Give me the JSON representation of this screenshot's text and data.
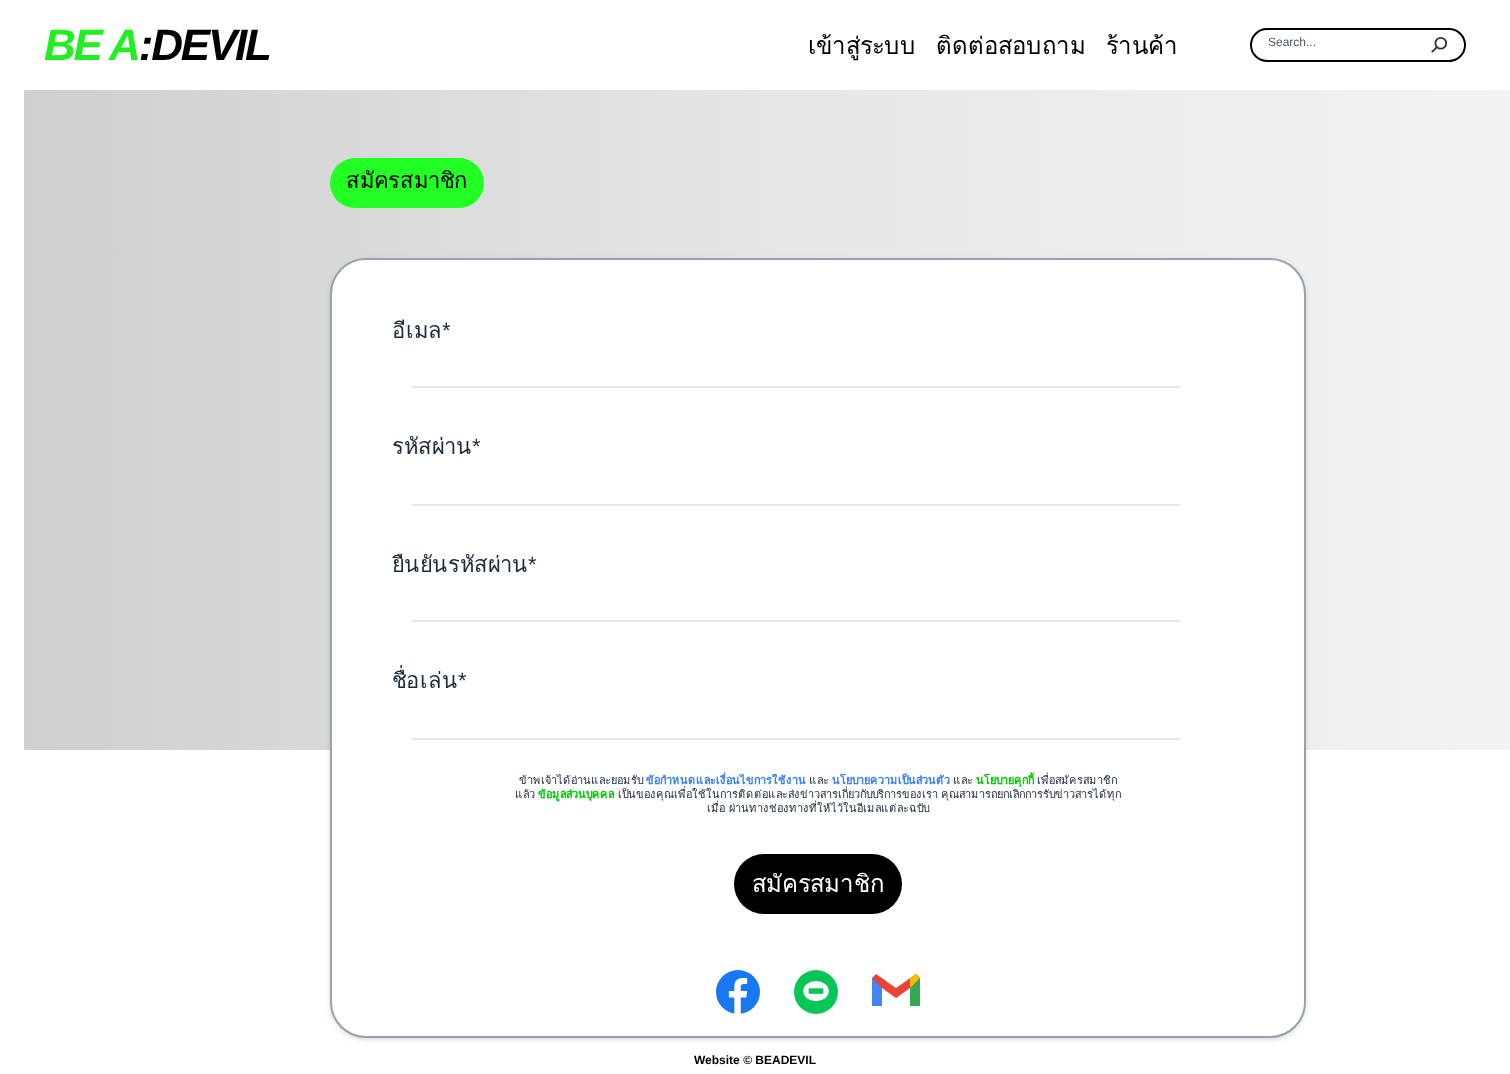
{
  "logo": {
    "part_1": "BE A",
    "part_2": ":DEVIL"
  },
  "nav": [
    {
      "label": "เข้าสู่ระบบ"
    },
    {
      "label": "ติดต่อสอบถาม"
    },
    {
      "label": "ร้านค้า"
    }
  ],
  "search": {
    "placeholder": "Search..."
  },
  "page_tag": "สมัครสมาชิก",
  "fields": [
    {
      "label": "อีเมล*"
    },
    {
      "label": "รหัสผ่าน*"
    },
    {
      "label": "ยืนยันรหัสผ่าน*"
    },
    {
      "label": "ชื่อเล่น*"
    }
  ],
  "consent": [
    {
      "kind": "text",
      "text": "ข้าพเจ้าได้อ่านและยอมรับ"
    },
    {
      "kind": "link",
      "color": "#3b82f6",
      "text": "ข้อกำหนดและเงื่อนไขการใช้งาน"
    },
    {
      "kind": "text",
      "text": "และ"
    },
    {
      "kind": "link",
      "color": "#3b82f6",
      "text": "นโยบายความเป็นส่วนตัว"
    },
    {
      "kind": "text",
      "text": "และ"
    },
    {
      "kind": "link",
      "color": "#00cc00",
      "text": "นโยบายคุกกี้"
    },
    {
      "kind": "text",
      "text": "เพื่อสมัครสมาชิกแล้ว"
    },
    {
      "kind": "link",
      "color": "#00cc00",
      "text": "ข้อมูลส่วนบุคคล"
    },
    {
      "kind": "text",
      "text": "เป็นของคุณเพื่อใช้ในการติดต่อและส่งข่าวสารเกี่ยวกับบริการของเรา คุณสามารถยกเลิกการรับข่าวสารได้ทุกเมื่อ ผ่านทางช่องทางที่ให้ไว้ในอีเมลแต่ละฉบับ"
    }
  ],
  "submit": "สมัครสมาชิก",
  "social": [
    {
      "kind": "facebook"
    },
    {
      "kind": "line"
    },
    {
      "kind": "gmail"
    }
  ],
  "footer": "Website © BEADEVIL"
}
